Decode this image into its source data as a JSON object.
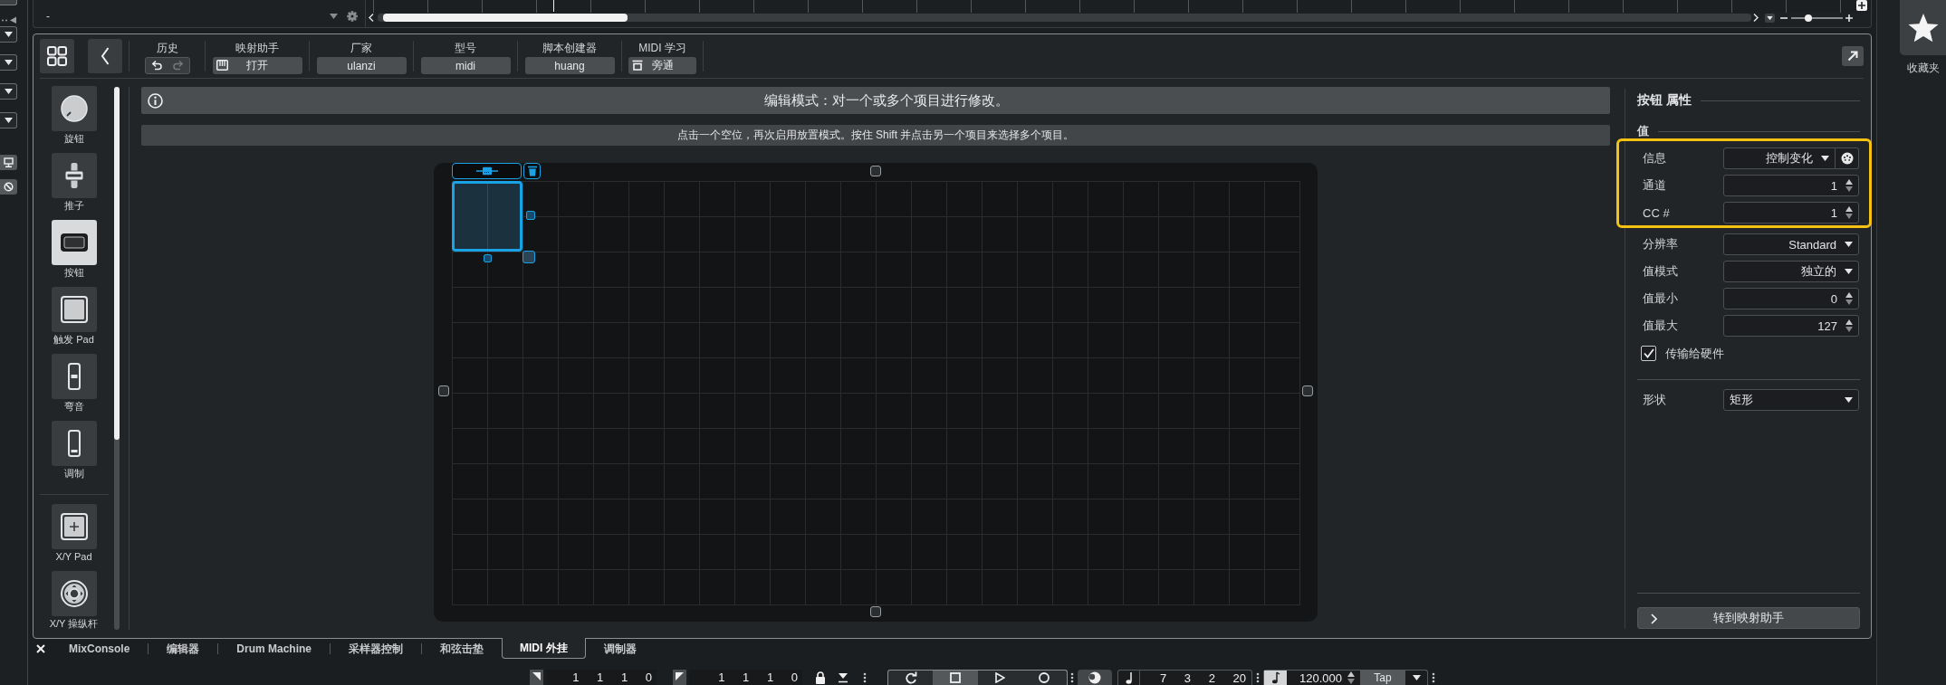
{
  "top_strip": {
    "track_value": "-",
    "zoom_slider": {
      "level": 0.33
    }
  },
  "favorites": {
    "label": "收藏夹"
  },
  "toolbar": {
    "groups": [
      {
        "kind": "history",
        "label": "历史",
        "actions": [
          {
            "kind": "undo",
            "disabled": false
          },
          {
            "kind": "redo",
            "disabled": true
          }
        ]
      },
      {
        "kind": "open",
        "label": "映射助手",
        "value": "打开"
      },
      {
        "kind": "field",
        "label": "厂家",
        "value": "ulanzi"
      },
      {
        "kind": "field",
        "label": "型号",
        "value": "midi"
      },
      {
        "kind": "field",
        "label": "脚本创建器",
        "value": "huang"
      },
      {
        "kind": "learn",
        "label": "MIDI 学习",
        "value": "旁通"
      }
    ]
  },
  "sidebar": {
    "groups": [
      {
        "items": [
          {
            "label": "旋钮",
            "kind": "knob",
            "selected": false
          },
          {
            "label": "推子",
            "kind": "fader",
            "selected": false
          },
          {
            "label": "按钮",
            "kind": "button",
            "selected": true
          },
          {
            "label": "触发 Pad",
            "kind": "pad",
            "selected": false
          },
          {
            "label": "弯音",
            "kind": "pitchbend",
            "selected": false
          },
          {
            "label": "调制",
            "kind": "modulation",
            "selected": false
          }
        ]
      },
      {
        "items": [
          {
            "label": "X/Y Pad",
            "kind": "xypad",
            "selected": false
          },
          {
            "label": "X/Y 操纵杆",
            "kind": "joystick",
            "selected": false
          }
        ]
      }
    ]
  },
  "info_bar": {
    "message": "编辑模式：对一个或多个项目进行修改。"
  },
  "hint_bar": {
    "message": "点击一个空位，再次启用放置模式。按住 Shift 并点击另一个项目来选择多个项目。"
  },
  "canvas": {
    "controls": [
      {
        "kind": "button",
        "selected": true
      }
    ]
  },
  "properties": {
    "title": "按钮 属性",
    "section": "值",
    "rows": [
      {
        "label": "信息",
        "kind": "midiselect",
        "value": "控制变化",
        "highlighted": true
      },
      {
        "label": "通道",
        "kind": "number",
        "value": "1",
        "highlighted": true
      },
      {
        "label": "CC #",
        "kind": "number",
        "value": "1",
        "highlighted": true
      },
      {
        "label": "分辨率",
        "kind": "select",
        "value": "Standard",
        "highlighted": false
      },
      {
        "label": "值模式",
        "kind": "select",
        "value": "独立的",
        "highlighted": false
      },
      {
        "label": "值最小",
        "kind": "number",
        "value": "0",
        "highlighted": false
      },
      {
        "label": "值最大",
        "kind": "number",
        "value": "127",
        "highlighted": false
      }
    ],
    "checkbox": {
      "label": "传输给硬件",
      "checked": true
    },
    "shape": {
      "label": "形状",
      "value": "矩形"
    },
    "footer_button": "转到映射助手"
  },
  "bottom_tabs": [
    {
      "label": "MixConsole",
      "selected": false
    },
    {
      "label": "编辑器",
      "selected": false
    },
    {
      "label": "Drum Machine",
      "selected": false
    },
    {
      "label": "采样器控制",
      "selected": false
    },
    {
      "label": "和弦击垫",
      "selected": false
    },
    {
      "label": "MIDI 外挂",
      "selected": true
    },
    {
      "label": "调制器",
      "selected": false
    }
  ],
  "transport": {
    "left_locator": "1 1 1 0",
    "right_locator": "1 1 1 0",
    "buttons": [
      {
        "kind": "cycle",
        "on": false
      },
      {
        "kind": "stop",
        "on": true
      },
      {
        "kind": "play",
        "on": false
      },
      {
        "kind": "record",
        "on": false
      }
    ],
    "position": "7 3 2 20",
    "tempo_toggle": {
      "on": true
    },
    "tempo": "120.000",
    "tap": "Tap"
  }
}
